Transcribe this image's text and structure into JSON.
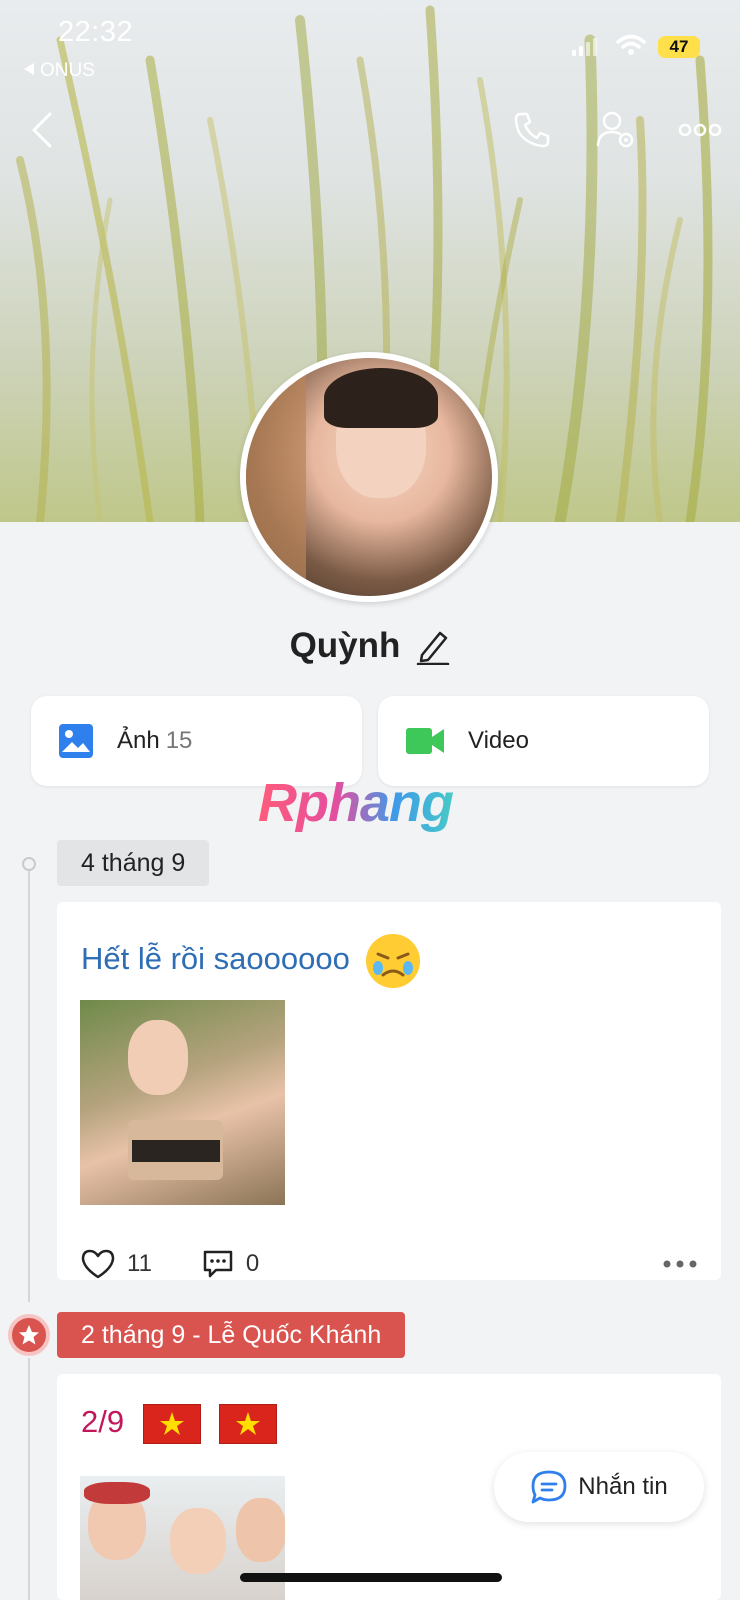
{
  "status_bar": {
    "time": "22:32",
    "back_app": "ONUS",
    "battery": "47"
  },
  "profile": {
    "name": "Quỳnh"
  },
  "media": {
    "photos_label": "Ảnh",
    "photos_count": "15",
    "video_label": "Video"
  },
  "watermark": "Rphang",
  "timeline": [
    {
      "date": "4 tháng 9",
      "post": {
        "text": "Hết lễ rồi saoooooo",
        "text_color": "#2f6db5",
        "likes": "11",
        "comments": "0"
      }
    },
    {
      "date": "2 tháng 9 - Lễ Quốc Khánh",
      "post": {
        "text": "2/9",
        "text_color": "#c2185b"
      }
    }
  ],
  "message_button": {
    "label": "Nhắn tin"
  },
  "colors": {
    "accent": "#d9534f",
    "photo_icon": "#2f80ed",
    "video_icon": "#3ec85a"
  },
  "icons": [
    "back-icon",
    "phone-icon",
    "user-settings-icon",
    "more-icon",
    "edit-icon",
    "image-icon",
    "video-camera-icon",
    "heart-icon",
    "comment-icon",
    "star-icon",
    "chat-icon"
  ]
}
